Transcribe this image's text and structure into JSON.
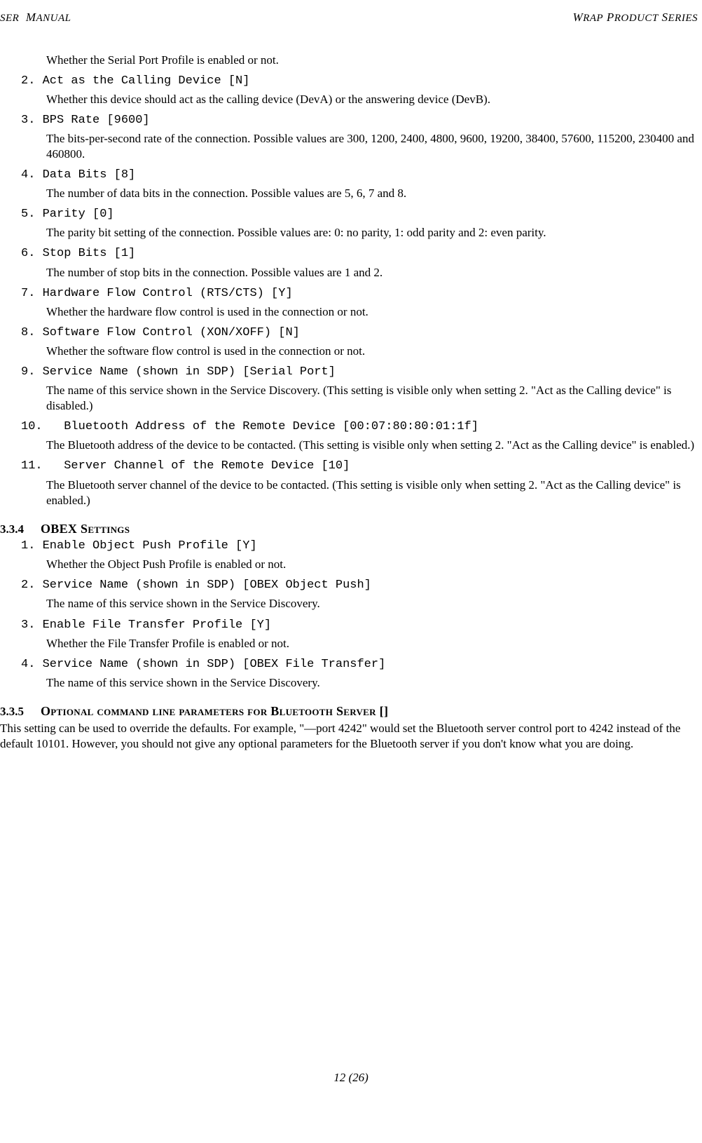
{
  "header": {
    "left_small": "SER",
    "left_word2_first": "M",
    "left_word2_rest": "ANUAL",
    "right_word1_first": "W",
    "right_word1_rest": "RAP",
    "right_word2_first": "P",
    "right_word2_rest": "RODUCT",
    "right_word3_first": "S",
    "right_word3_rest": "ERIES"
  },
  "items": {
    "i1_desc": "Whether the Serial Port Profile is enabled or not.",
    "i2_num": "2. Act as the Calling Device [N]",
    "i2_desc": "Whether this device should act as the calling device (DevA) or the answering device (DevB).",
    "i3_num": "3. BPS Rate [9600]",
    "i3_desc": "The bits-per-second rate of the connection. Possible values are 300, 1200, 2400, 4800, 9600, 19200, 38400, 57600, 115200, 230400 and 460800.",
    "i4_num": "4. Data Bits [8]",
    "i4_desc": "The number of data bits in the connection. Possible values are 5, 6, 7 and 8.",
    "i5_num": "5. Parity [0]",
    "i5_desc": "The parity bit setting of the connection. Possible values are: 0: no parity, 1: odd parity and 2: even parity.",
    "i6_num": "6. Stop Bits [1]",
    "i6_desc": "The number of stop bits in the connection. Possible values are 1 and 2.",
    "i7_num": "7. Hardware Flow Control (RTS/CTS) [Y]",
    "i7_desc": "Whether the hardware flow control is used in the connection or not.",
    "i8_num": "8. Software Flow Control (XON/XOFF) [N]",
    "i8_desc": "Whether the software flow control is used in the connection or not.",
    "i9_num": "9. Service Name (shown in SDP) [Serial Port]",
    "i9_desc": "The name of this service shown in the Service Discovery. (This setting is visible only when setting 2. \"Act as the Calling device\" is disabled.)",
    "i10_num": "10.   Bluetooth Address of the Remote Device [00:07:80:80:01:1f]",
    "i10_desc": "The Bluetooth address of the device to be contacted. (This setting is visible only when setting 2. \"Act as the Calling device\" is enabled.)",
    "i11_num": "11.   Server Channel of the Remote Device [10]",
    "i11_desc": "The Bluetooth server channel of the device to be contacted. (This setting is visible only when setting 2. \"Act as the Calling device\" is enabled.)"
  },
  "sec334": {
    "num": "3.3.4",
    "title": "OBEX Settings",
    "o1_num": "1. Enable Object Push Profile [Y]",
    "o1_desc": "Whether the Object Push Profile is enabled or not.",
    "o2_num": "2. Service Name (shown in SDP) [OBEX Object Push]",
    "o2_desc": "The name of this service shown in the Service Discovery.",
    "o3_num": "3. Enable File Transfer Profile [Y]",
    "o3_desc": "Whether the File Transfer Profile is enabled or not.",
    "o4_num": "4. Service Name (shown in SDP) [OBEX File Transfer]",
    "o4_desc": "The name of this service shown in the Service Discovery."
  },
  "sec335": {
    "num": "3.3.5",
    "title": "Optional command line parameters for Bluetooth Server []",
    "body": "This setting can be used to override the defaults. For example, \"—port 4242\" would set the Bluetooth server control port to 4242 instead of the default 10101. However, you should not give any optional parameters for the Bluetooth server if you don't know what you are doing."
  },
  "footer": "12 (26)"
}
